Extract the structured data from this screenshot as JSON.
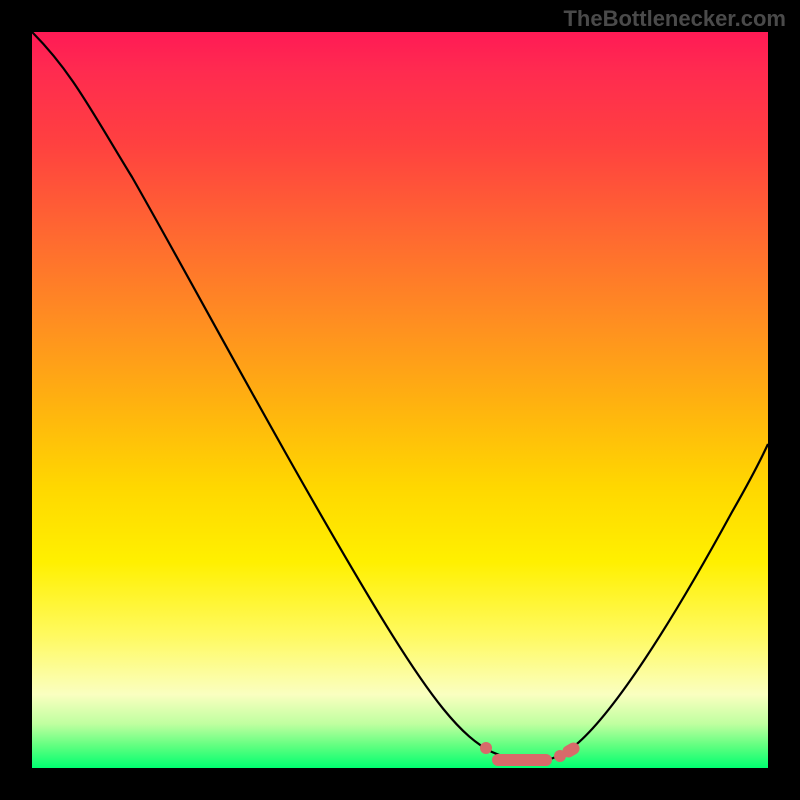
{
  "watermark": "TheBottlenecker.com",
  "chart_data": {
    "type": "line",
    "title": "",
    "xlabel": "",
    "ylabel": "",
    "xlim": [
      0,
      100
    ],
    "ylim": [
      0,
      100
    ],
    "x": [
      0,
      5,
      10,
      15,
      20,
      25,
      30,
      35,
      40,
      45,
      50,
      55,
      60,
      62,
      64,
      66,
      68,
      70,
      72,
      75,
      80,
      85,
      90,
      95,
      100
    ],
    "values": [
      100,
      97,
      92,
      86,
      79,
      71,
      63,
      54,
      45,
      36,
      27,
      18,
      10,
      7,
      4,
      2,
      1,
      1,
      2,
      5,
      12,
      22,
      33,
      44,
      55
    ],
    "min_region": {
      "x_start": 62,
      "x_end": 74,
      "y": 1
    },
    "background_gradient": [
      "#ff1a55",
      "#ffd800",
      "#00ff70"
    ],
    "colors": {
      "curve": "#000000",
      "marker": "#d86a6a"
    }
  }
}
